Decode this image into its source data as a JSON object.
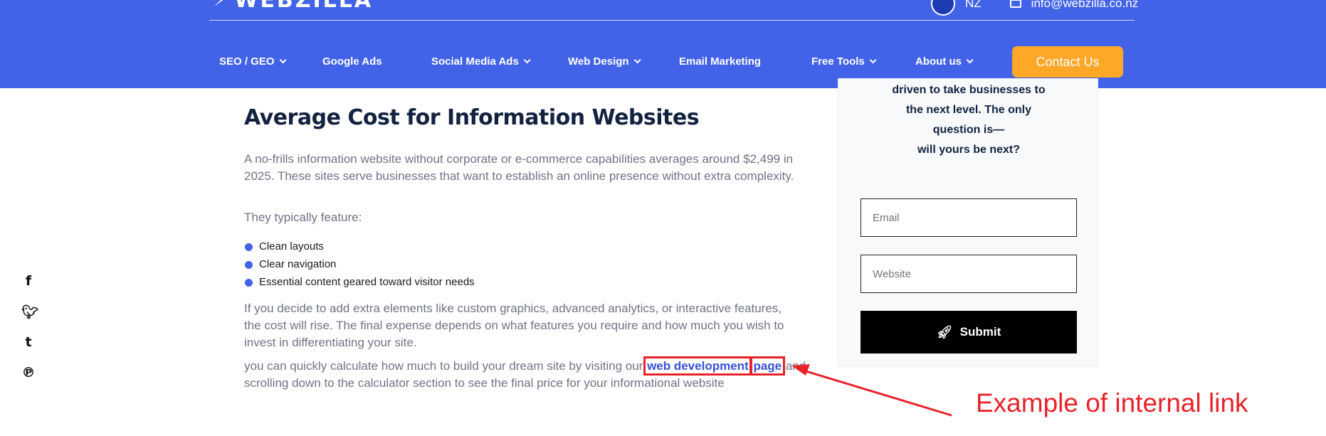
{
  "header": {
    "logo_text": "WEBZILLA",
    "lang": "NZ",
    "email": "info@webzilla.co.nz",
    "contact_label": "Contact Us",
    "colors": {
      "background": "#4263e8",
      "contact_button": "#ffa726"
    }
  },
  "nav": {
    "items": [
      {
        "label": "SEO / GEO",
        "has_dropdown": true
      },
      {
        "label": "Google Ads",
        "has_dropdown": false
      },
      {
        "label": "Social Media Ads",
        "has_dropdown": true
      },
      {
        "label": "Web Design",
        "has_dropdown": true
      },
      {
        "label": "Email Marketing",
        "has_dropdown": false
      },
      {
        "label": "Free Tools",
        "has_dropdown": true
      },
      {
        "label": "About us",
        "has_dropdown": true
      }
    ]
  },
  "social": {
    "icons": [
      "facebook-icon",
      "twitter-icon",
      "tumblr-icon",
      "pinterest-icon"
    ]
  },
  "article": {
    "title": "Average Cost for Information Websites",
    "p1": "A no-frills information website without corporate or e-commerce capabilities averages around $2,499 in 2025. These sites serve businesses that want to establish an online presence without extra complexity.",
    "p2": "They typically feature:",
    "bullets": [
      "Clean layouts",
      "Clear navigation",
      "Essential content geared toward visitor needs"
    ],
    "p3": "If you decide to add extra elements like custom graphics, advanced analytics, or interactive features, the cost will rise. The final expense depends on what features you require and how much you wish to invest in differentiating your site.",
    "p4_before": "you can quickly calculate how much to build your dream site by visiting our ",
    "link_part1": "web development",
    "link_part2": "page",
    "p4_after": " and scrolling down to the calculator section to see the final price for your informational website"
  },
  "sidebar": {
    "text_lines": [
      "driven to take businesses to",
      "the next level. The only",
      "question is—",
      "will yours be next?"
    ],
    "email_placeholder": "Email",
    "website_placeholder": "Website",
    "submit_label": "Submit"
  },
  "annotation": {
    "label": "Example of internal link",
    "color": "#e8222a"
  }
}
